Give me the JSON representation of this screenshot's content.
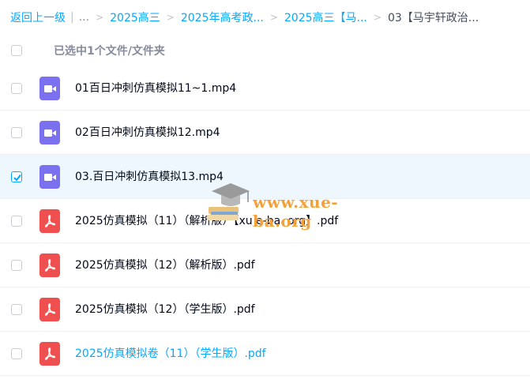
{
  "breadcrumb": {
    "back": "返回上一级",
    "ellipsis": "...",
    "items": [
      "2025高三",
      "2025年高考政...",
      "2025高三【马...",
      "03【马宇轩政治..."
    ]
  },
  "header": {
    "selected_text": "已选中1个文件/文件夹"
  },
  "files": [
    {
      "name": "01百日冲刺仿真模拟11~1.mp4",
      "type": "video",
      "checked": false
    },
    {
      "name": "02百日冲刺仿真模拟12.mp4",
      "type": "video",
      "checked": false
    },
    {
      "name": "03.百日冲刺仿真模拟13.mp4",
      "type": "video",
      "checked": true
    },
    {
      "name": "2025仿真模拟（11）（解析版）【xu e-ba. org】.pdf",
      "type": "pdf",
      "checked": false
    },
    {
      "name": "2025仿真模拟（12）（解析版）.pdf",
      "type": "pdf",
      "checked": false
    },
    {
      "name": "2025仿真模拟（12）（学生版）.pdf",
      "type": "pdf",
      "checked": false
    },
    {
      "name": "2025仿真模拟卷（11）（学生版）.pdf",
      "type": "pdf",
      "checked": false
    }
  ],
  "watermark": {
    "text": "www.xue-ba.org"
  },
  "colors": {
    "accent": "#06a7ff",
    "video_icon": "#7b70f0",
    "pdf_icon": "#f04f4f",
    "watermark": "#f3a23b"
  }
}
